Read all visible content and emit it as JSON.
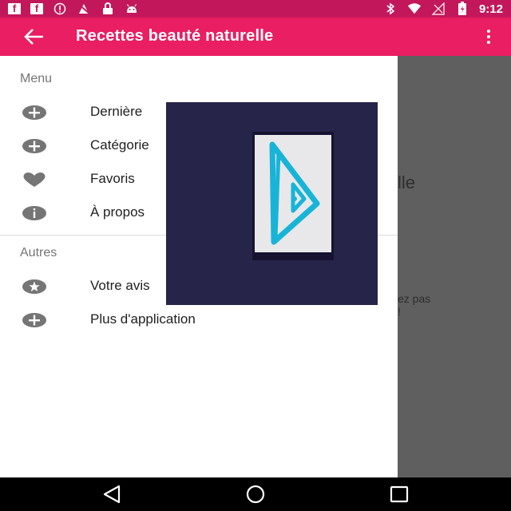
{
  "status_bar": {
    "icons": [
      "facebook-icon",
      "facebook-icon",
      "info-circle-icon",
      "fire-no-ads-icon",
      "lock-icon",
      "android-icon",
      "bluetooth-icon",
      "wifi-icon",
      "signal-icon",
      "battery-charging-icon"
    ],
    "time": "9:12",
    "background": "#c2185b"
  },
  "app_bar": {
    "title": "Recettes beauté naturelle",
    "background": "#e91e63"
  },
  "drawer": {
    "section_menu": "Menu",
    "menu_items": [
      {
        "label": "Dernière",
        "icon": "plus-circle-icon"
      },
      {
        "label": "Catégorie",
        "icon": "plus-circle-icon"
      },
      {
        "label": "Favoris",
        "icon": "heart-icon"
      },
      {
        "label": "À propos",
        "icon": "info-circle-icon"
      }
    ],
    "section_other": "Autres",
    "other_items": [
      {
        "label": "Votre avis",
        "icon": "star-circle-icon"
      },
      {
        "label": "Plus d'application",
        "icon": "plus-circle-icon"
      }
    ]
  },
  "background_content": {
    "title_fragment": "lle",
    "text_line_1": "ez pas",
    "text_line_2": "!"
  },
  "nav_bar": {
    "icons": [
      "back-triangle-icon",
      "home-circle-icon",
      "recents-square-icon"
    ]
  }
}
